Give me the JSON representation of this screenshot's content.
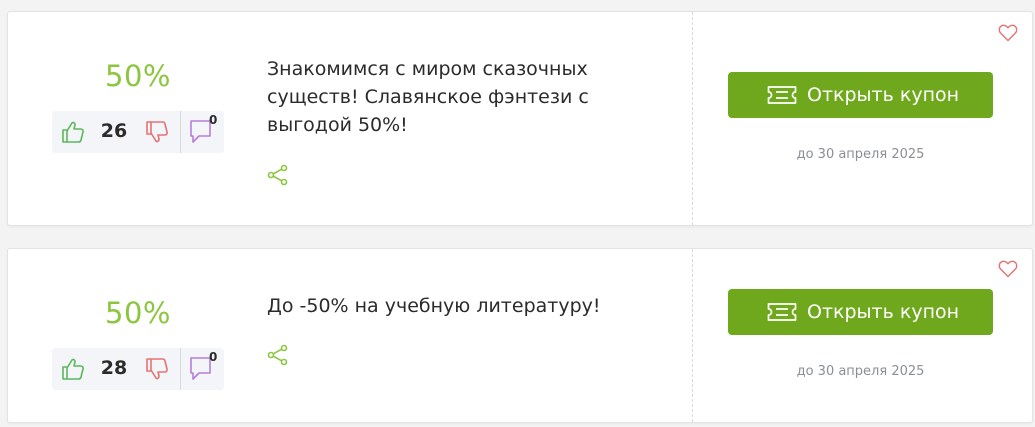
{
  "colors": {
    "discount": "#8cc63f",
    "button": "#6fa81d",
    "thumb_up": "#5cb85c",
    "thumb_down": "#e57373",
    "comment": "#b57edc",
    "share": "#8cc63f",
    "heart": "#e57373"
  },
  "coupons": [
    {
      "discount": "50%",
      "votes": "26",
      "comments": "0",
      "title": "Знакомимся с миром сказочных существ! Славянское фэнтези с выгодой 50%!",
      "button_label": "Открыть купон",
      "expiry": "до 30 апреля 2025",
      "icons": [
        "thumb-up-icon",
        "thumb-down-icon",
        "comment-icon",
        "share-icon",
        "ticket-icon",
        "heart-icon"
      ]
    },
    {
      "discount": "50%",
      "votes": "28",
      "comments": "0",
      "title": "До -50% на учебную литературу!",
      "button_label": "Открыть купон",
      "expiry": "до 30 апреля 2025",
      "icons": [
        "thumb-up-icon",
        "thumb-down-icon",
        "comment-icon",
        "share-icon",
        "ticket-icon",
        "heart-icon"
      ]
    }
  ]
}
